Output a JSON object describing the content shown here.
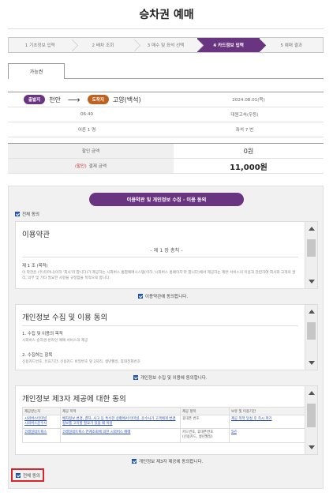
{
  "page": {
    "title": "승차권 예매"
  },
  "steps": [
    {
      "label": "1 기초정보 입력",
      "active": false
    },
    {
      "label": "2 배차 조회",
      "active": false
    },
    {
      "label": "3 매수 및 좌석 선택",
      "active": false
    },
    {
      "label": "4 카드정보 입력",
      "active": true
    },
    {
      "label": "5 예매 결과",
      "active": false
    }
  ],
  "tab": {
    "label": "가능권"
  },
  "trip": {
    "departure_badge": "출발지",
    "departure": "천안",
    "arrow": "⟶",
    "arrival_badge": "도착지",
    "arrival": "고양(백석)",
    "date": "2024.08.01(목)",
    "time": "06:40",
    "bus": "대원고속(우등)",
    "passengers": "어른 1 명",
    "seat": "좌석 7 번"
  },
  "payment": {
    "discount_label": "할인 금액",
    "discount_value": "0원",
    "total_tag": "(할인)",
    "total_label": "결제 금액",
    "total_value": "11,000원"
  },
  "agreement": {
    "title_button": "이용약관 및 개인정보 수집 · 이용 동의",
    "all_agree": "전체 동의",
    "terms": {
      "heading": "이용약관",
      "chapter": "- 제 1 장 총칙 -",
      "article": "제 1 조 (목적)",
      "body": "이 약관은 (주)티머니(이하 '회사'라 합니다)가 제공하는 시외버스 통합예매시스템(이하 '시외버스 홈페이지'라 합니다)에서 제공하는 제반 서비스의 이용과 관련하여 회사와 고객의 권리, 의무 및 기타 필요한 사항을 규정함을 목적으로 합니다.",
      "check_label": "이용약관에 동의합니다."
    },
    "privacy": {
      "heading": "개인정보 수집 및 이용 동의",
      "item1": "1. 수집 및 이용의 목적",
      "item1_text": "시외버스 승차권 온라인 예매 서비스의 제공",
      "item2": "2. 수집하는 항목",
      "item2_text": "신용카드번호, 유효기간, 신용카드 비밀번호 앞 2자리, 생년월일, 휴대전화번호",
      "check_label": "개인정보 수집 및 이용에 동의합니다."
    },
    "third_party": {
      "heading": "개인정보 제3자 제공에 대한 동의",
      "headers": [
        "제공받는자",
        "제공 목적",
        "제공 항목",
        "보유 및 이용기간"
      ],
      "rows": [
        [
          "시외버스터미널\n시외버스운수사",
          "배차정보 변경, 결차, 사고 등 특수한 상황에서 터미널, 운수사가 고객에게 변경 정보를 고지할 필요가 있을 때 이용",
          "휴대폰 번호",
          "제공 목적 달성 후 즉시 파기"
        ],
        [
          "코레일네트웍스",
          "코레일네트웍스 연계조회에 의한 시외버스 예매",
          "카드번호, 휴대폰번호\n(신용카드, 생년월일)",
          "5년"
        ]
      ],
      "check_label": "개인정보 제3자 제공에 동의합니다."
    },
    "bottom_all_agree": "전체 동의"
  }
}
